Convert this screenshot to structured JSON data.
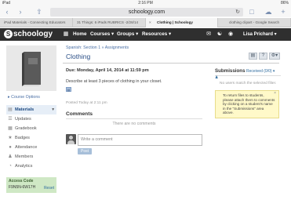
{
  "status_bar": {
    "device": "iPad",
    "time": "2:16 PM",
    "battery": "86%"
  },
  "browser": {
    "url": "schoology.com",
    "tabs": [
      {
        "label": "iPad Materials - Connecting Educators",
        "active": false
      },
      {
        "label": "31 Things: 6 iPads RUBRICS -2/28/14",
        "active": false
      },
      {
        "label": "Clothing | Schoology",
        "active": true
      },
      {
        "label": "clothing clipart - Google Search",
        "active": false
      }
    ]
  },
  "nav": {
    "logo": "schoology",
    "items": [
      "Home",
      "Courses ▾",
      "Groups ▾",
      "Resources ▾"
    ],
    "user": "Lisa Prichard ▾"
  },
  "sidebar": {
    "course_options": "▸ Course Options",
    "items": [
      {
        "label": "Materials",
        "icon": "materials-icon"
      },
      {
        "label": "Updates",
        "icon": "updates-icon"
      },
      {
        "label": "Gradebook",
        "icon": "gradebook-icon"
      },
      {
        "label": "Badges",
        "icon": "badges-icon"
      },
      {
        "label": "Attendance",
        "icon": "attendance-icon"
      },
      {
        "label": "Members",
        "icon": "members-icon"
      },
      {
        "label": "Analytics",
        "icon": "analytics-icon"
      }
    ],
    "access_code": {
      "title": "Access Code",
      "code": "F9N5N-6W17H",
      "reset": "Reset"
    }
  },
  "assignment": {
    "breadcrumb": "Spanish: Section 1 » Assignments",
    "title": "Clothing",
    "due": "Due: Monday, April 14, 2014 at 11:59 pm",
    "description": "Describe at least 3 pieces of clothing in your closet.",
    "posted": "Posted Today at 2:11 pm"
  },
  "comments": {
    "heading": "Comments",
    "empty": "There are no comments",
    "placeholder": "Write a comment",
    "post": "Post"
  },
  "submissions": {
    "heading": "Submissions",
    "received": "Received (0/0) ▾",
    "none": "No users match the selected filter.",
    "tip": "To return files to students, please attach them to comments by clicking on a student's name in the \"Submissions\" area above."
  }
}
